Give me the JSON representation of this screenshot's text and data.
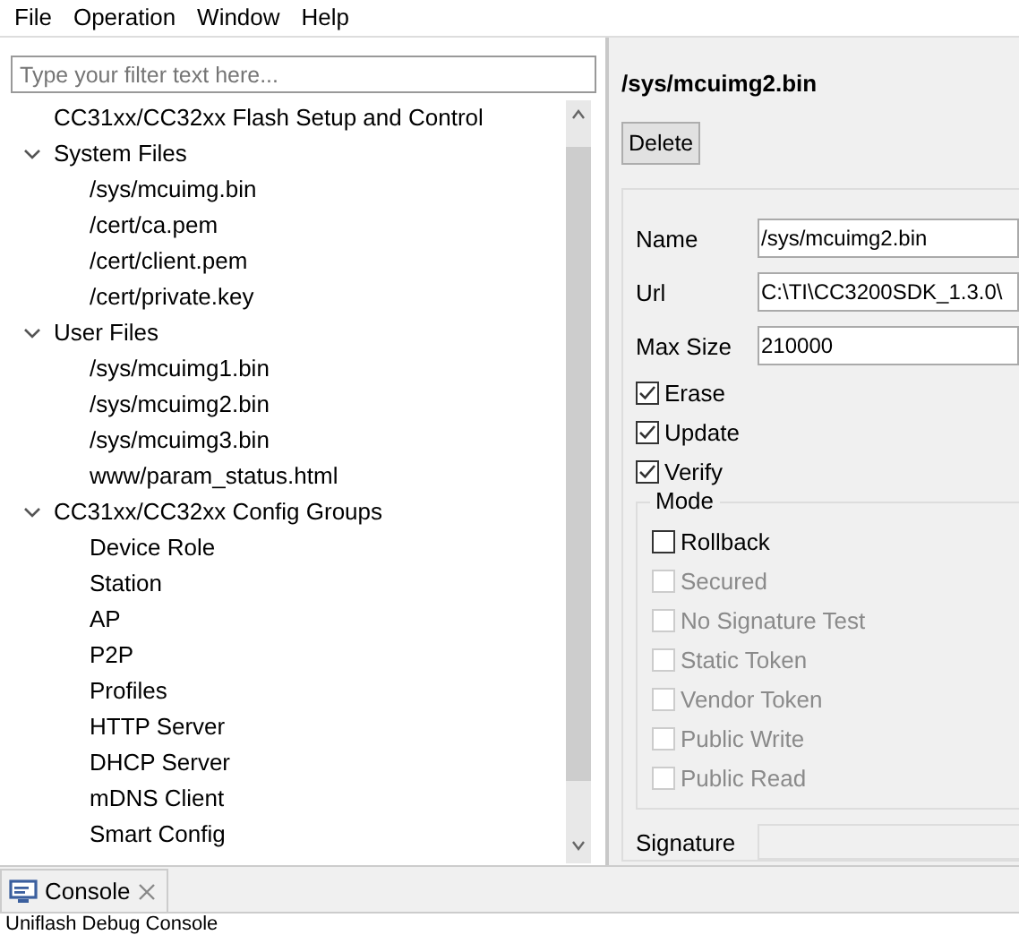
{
  "menu": [
    "File",
    "Operation",
    "Window",
    "Help"
  ],
  "filter": {
    "placeholder": "Type your filter text here..."
  },
  "tree": [
    {
      "label": "CC31xx/CC32xx Flash Setup and Control"
    },
    {
      "label": "System Files",
      "expanded": true,
      "children": [
        {
          "label": "/sys/mcuimg.bin"
        },
        {
          "label": "/cert/ca.pem"
        },
        {
          "label": "/cert/client.pem"
        },
        {
          "label": "/cert/private.key"
        }
      ]
    },
    {
      "label": "User Files",
      "expanded": true,
      "children": [
        {
          "label": "/sys/mcuimg1.bin"
        },
        {
          "label": "/sys/mcuimg2.bin"
        },
        {
          "label": "/sys/mcuimg3.bin"
        },
        {
          "label": "www/param_status.html"
        }
      ]
    },
    {
      "label": "CC31xx/CC32xx Config Groups",
      "expanded": true,
      "children": [
        {
          "label": "Device Role"
        },
        {
          "label": "Station"
        },
        {
          "label": "AP"
        },
        {
          "label": "P2P"
        },
        {
          "label": "Profiles"
        },
        {
          "label": "HTTP Server"
        },
        {
          "label": "DHCP Server"
        },
        {
          "label": "mDNS Client"
        },
        {
          "label": "Smart Config"
        }
      ]
    }
  ],
  "detail": {
    "title": "/sys/mcuimg2.bin",
    "delete_button": "Delete",
    "fields": [
      {
        "label": "Name",
        "value": "/sys/mcuimg2.bin"
      },
      {
        "label": "Url",
        "value": "C:\\TI\\CC3200SDK_1.3.0\\"
      },
      {
        "label": "Max Size",
        "value": "210000"
      }
    ],
    "options": [
      {
        "label": "Erase",
        "checked": true,
        "disabled": false
      },
      {
        "label": "Update",
        "checked": true,
        "disabled": false
      },
      {
        "label": "Verify",
        "checked": true,
        "disabled": false
      }
    ],
    "mode": {
      "title": "Mode",
      "options": [
        {
          "label": "Rollback",
          "checked": false,
          "disabled": false
        },
        {
          "label": "Secured",
          "checked": false,
          "disabled": true
        },
        {
          "label": "No Signature Test",
          "checked": false,
          "disabled": true
        },
        {
          "label": "Static Token",
          "checked": false,
          "disabled": true
        },
        {
          "label": "Vendor Token",
          "checked": false,
          "disabled": true
        },
        {
          "label": "Public Write",
          "checked": false,
          "disabled": true
        },
        {
          "label": "Public Read",
          "checked": false,
          "disabled": true
        }
      ]
    },
    "signature": {
      "label": "Signature"
    }
  },
  "console": {
    "tab": "Console",
    "text": "Uniflash Debug Console"
  }
}
